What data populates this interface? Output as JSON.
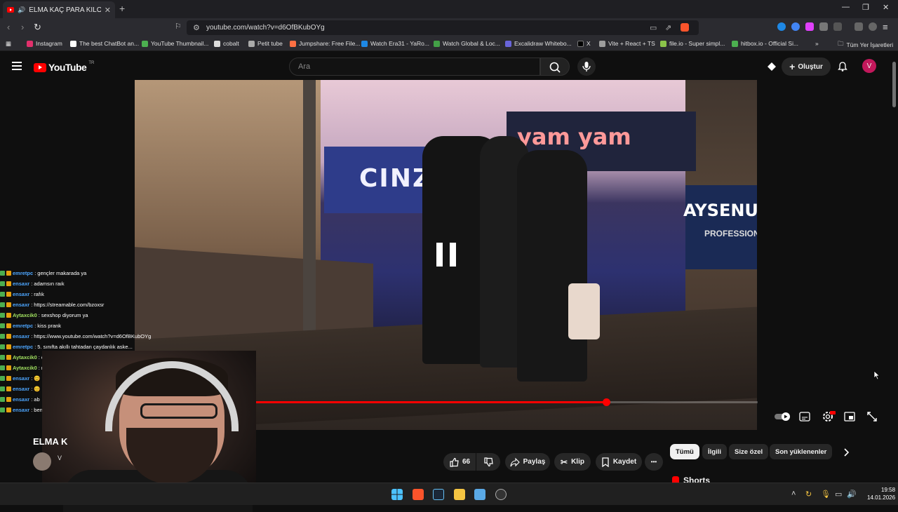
{
  "browser": {
    "tab_title": "ELMA KAÇ PARA KİLOSU - Yo",
    "url": "youtube.com/watch?v=d6OfBKubOYg",
    "new_tab": "+",
    "bookmarks": [
      {
        "label": "Instagram",
        "color": "#e1306c"
      },
      {
        "label": "The best ChatBot an...",
        "color": "#ffffff"
      },
      {
        "label": "YouTube Thumbnail...",
        "color": "#4caf50"
      },
      {
        "label": "cobalt",
        "color": "#dddddd"
      },
      {
        "label": "Petit tube",
        "color": "#aaaaaa"
      },
      {
        "label": "Jumpshare: Free File...",
        "color": "#ff7043"
      },
      {
        "label": "Watch Era31 - YaRo...",
        "color": "#1e88e5"
      },
      {
        "label": "Watch Global & Loc...",
        "color": "#43a047"
      },
      {
        "label": "Excalidraw Whitebo...",
        "color": "#6965db"
      },
      {
        "label": "X",
        "color": "#000000"
      },
      {
        "label": "Vite + React + TS",
        "color": "#9e9e9e"
      },
      {
        "label": "file.io - Super simpl...",
        "color": "#8bc34a"
      },
      {
        "label": "hitbox.io - Official Si...",
        "color": "#4caf50"
      }
    ],
    "bookmarks_more": "»",
    "all_bookmarks": "Tüm Yer İşaretleri"
  },
  "youtube": {
    "logo": "YouTube",
    "country": "TR",
    "search_placeholder": "Ara",
    "create_label": "Oluştur",
    "avatar_letter": "V"
  },
  "video": {
    "title": "ELMA K",
    "channel_initial": "V",
    "progress_fraction": 0.73,
    "likes": "66",
    "share": "Paylaş",
    "clip": "Klip",
    "save": "Kaydet",
    "more": "•••",
    "scene_signs": {
      "store": "CINZ",
      "yam": "yam yam",
      "right": "AYSENUR",
      "right_sub": "PROFESSIONA"
    }
  },
  "chat": [
    {
      "user": "emretpc",
      "msg": "gençler makarada ya",
      "color": "#4da6ff"
    },
    {
      "user": "ensaxr",
      "msg": "adamsın raık",
      "color": "#4da6ff"
    },
    {
      "user": "ensaxr",
      "msg": "rafık",
      "color": "#4da6ff"
    },
    {
      "user": "ensaxr",
      "msg": "https://streamable.com/bzoxsr",
      "color": "#4da6ff"
    },
    {
      "user": "Aytaxcik0",
      "msg": "sexshop diyorum ya",
      "color": "#a0e060"
    },
    {
      "user": "emretpc",
      "msg": "kiss prank",
      "color": "#4da6ff"
    },
    {
      "user": "ensaxr",
      "msg": "https://www.youtube.com/watch?v=d6OfBKubOYg",
      "color": "#4da6ff"
    },
    {
      "user": "emretpc",
      "msg": "5. sınıfta akıllı tahtadan çaydanlık aske...",
      "color": "#4da6ff"
    },
    {
      "user": "Aytaxcik0",
      "msg": "öpüşenler vardı ya onu...",
      "color": "#a0e060"
    },
    {
      "user": "Aytaxcik0",
      "msg": "nası lan ben orta okul",
      "color": "#a0e060"
    },
    {
      "user": "ensaxr",
      "msg": "😊",
      "color": "#4da6ff"
    },
    {
      "user": "ensaxr",
      "msg": "😊",
      "color": "#4da6ff"
    },
    {
      "user": "ensaxr",
      "msg": "ab",
      "color": "#4da6ff"
    },
    {
      "user": "ensaxr",
      "msg": "ben daha mı",
      "color": "#4da6ff"
    }
  ],
  "chips": [
    {
      "label": "Tümü",
      "active": true
    },
    {
      "label": "İlgili",
      "active": false
    },
    {
      "label": "Size özel",
      "active": false
    },
    {
      "label": "Son yüklenenler",
      "active": false
    }
  ],
  "sidebar": {
    "shorts_label": "Shorts"
  },
  "taskbar": {
    "time": "19:58",
    "date": "14.01.2026"
  }
}
